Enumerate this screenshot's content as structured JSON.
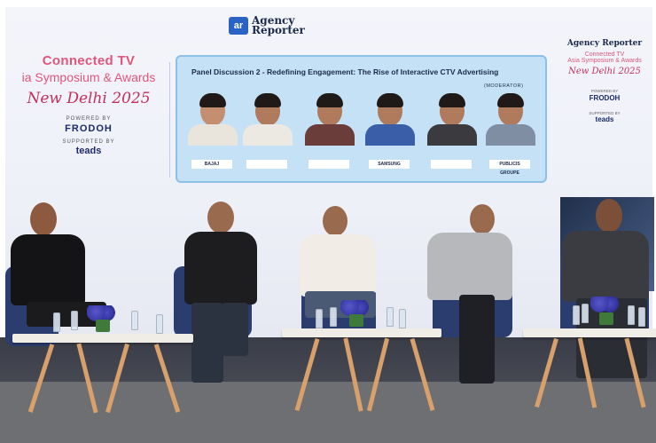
{
  "backdrop": {
    "event_line1": "Connected TV",
    "event_line2": "ia Symposium & Awards",
    "event_location": "New Delhi 2025",
    "powered_by_label": "POWERED BY",
    "powered_by": "FRODOH",
    "supported_by_label": "SUPPORTED BY",
    "supported_by": "teads",
    "logo_mark": "ar",
    "logo_name_line1": "Agency",
    "logo_name_line2": "Reporter"
  },
  "panel": {
    "title": "Panel Discussion 2 - Redefining Engagement: The Rise of Interactive CTV Advertising",
    "moderator_label": "(MODERATOR)",
    "speakers": [
      {
        "company": "BAJAJ"
      },
      {
        "company": ""
      },
      {
        "company": ""
      },
      {
        "company": "SAMSUNG"
      },
      {
        "company": ""
      },
      {
        "company": "PUBLICIS GROUPE"
      }
    ]
  },
  "right_brand": {
    "logo": "Agency Reporter",
    "line1": "Connected TV",
    "line2": "Asia Symposium & Awards",
    "location": "New Delhi 2025",
    "powered_by_label": "POWERED BY",
    "powered_by": "FRODOH",
    "supported_by_label": "SUPPORTED BY",
    "supported_by": "teads"
  }
}
